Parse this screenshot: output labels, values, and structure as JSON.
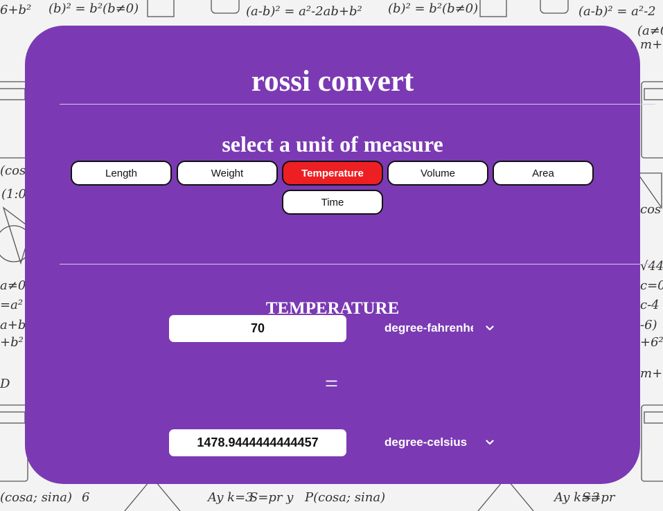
{
  "app": {
    "title": "rossi convert"
  },
  "selector": {
    "heading": "select a unit of measure"
  },
  "units": [
    {
      "label": "Length"
    },
    {
      "label": "Weight"
    },
    {
      "label": "Temperature",
      "active": true
    },
    {
      "label": "Volume"
    },
    {
      "label": "Area"
    },
    {
      "label": "Time"
    }
  ],
  "converter": {
    "heading": "TEMPERATURE",
    "input_value": "70",
    "from_unit": "degree-fahrenheit",
    "equals_sign": "=",
    "output_value": "1478.9444444444457",
    "to_unit": "degree-celsius"
  },
  "colors": {
    "card": "#7b3ab3",
    "active_button": "#ee1f22"
  },
  "icons": {
    "dropdown": "chevron-down-icon"
  }
}
